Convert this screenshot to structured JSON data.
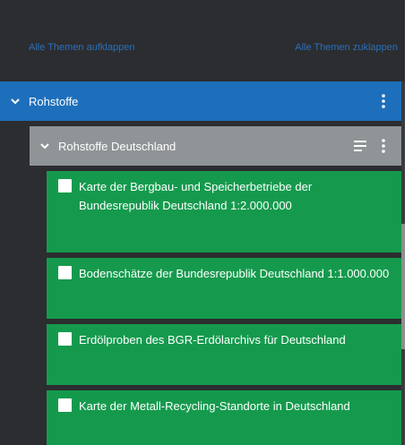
{
  "toolbar": {
    "expand_all": "Alle Themen aufklappen",
    "collapse_all": "Alle Themen zuklappen"
  },
  "tree": {
    "level1": {
      "label": "Rohstoffe",
      "icon": "chevron-down-icon",
      "menu_icon": "kebab-menu-icon"
    },
    "level2": {
      "label": "Rohstoffe Deutschland",
      "icon": "chevron-down-icon",
      "list_icon": "list-icon",
      "menu_icon": "kebab-menu-icon"
    },
    "layers": [
      {
        "label": "Karte der Bergbau- und Speicherbetriebe der Bundesrepublik Deutschland 1:2.000.000",
        "checked": false
      },
      {
        "label": "Bodenschätze der Bundesrepublik Deutschland 1:1.000.000",
        "checked": false
      },
      {
        "label": "Erdölproben des BGR-Erdölarchivs für Deutschland",
        "checked": false
      },
      {
        "label": "Karte der Metall-Recycling-Standorte in Deutschland",
        "checked": false
      }
    ]
  },
  "colors": {
    "panel_bg": "#2c2d30",
    "level1_bg": "#1e6fbb",
    "level2_bg": "#8f9497",
    "layer_bg": "#159a4d",
    "link": "#2a6fb8"
  }
}
